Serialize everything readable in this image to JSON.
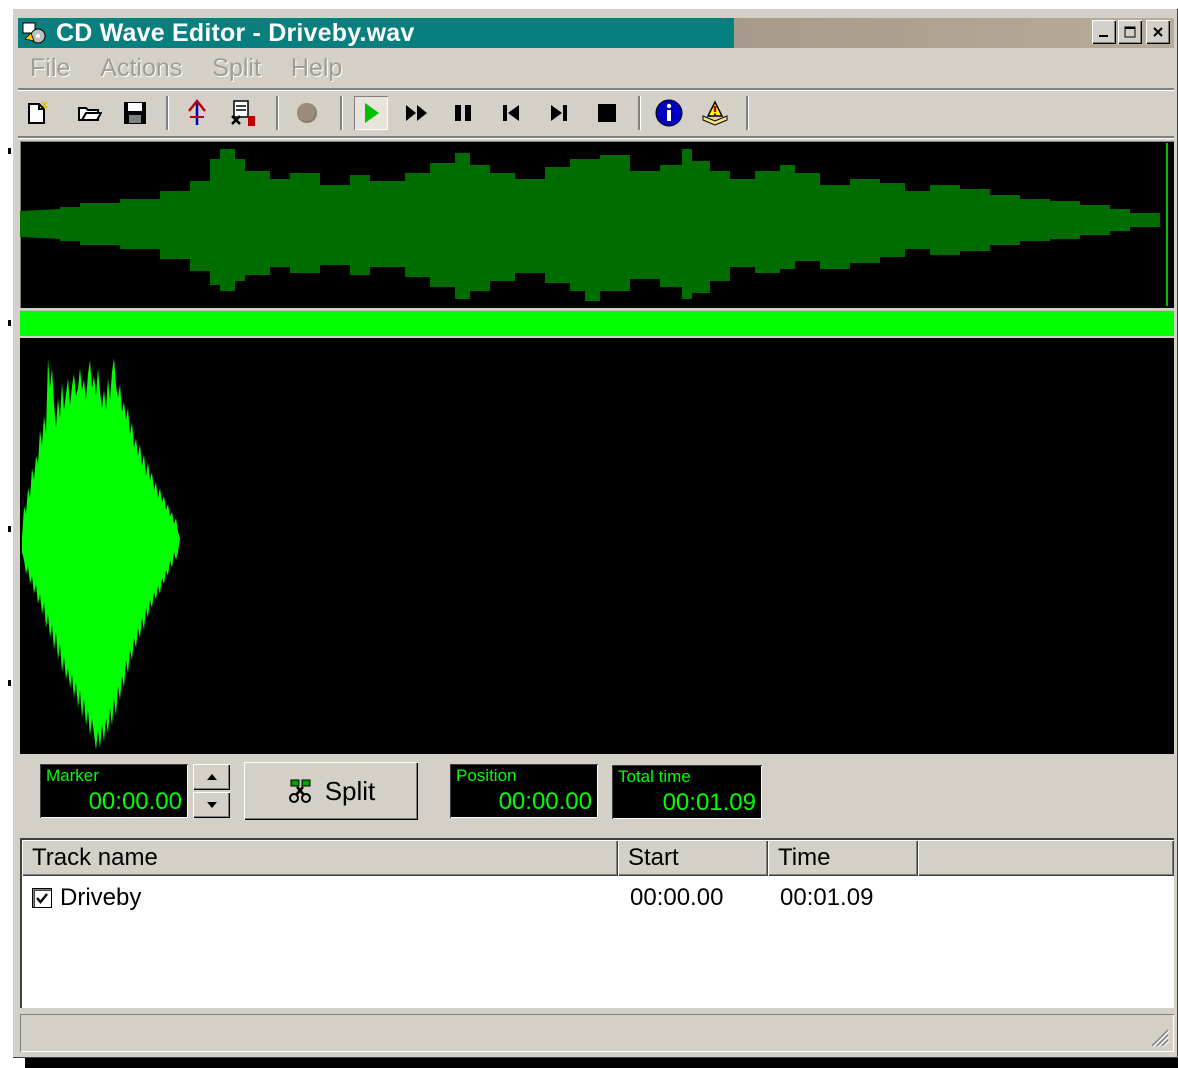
{
  "window": {
    "title": "CD Wave Editor - Driveby.wav",
    "minimize_symbol": "_",
    "maximize_symbol": "□",
    "close_symbol": "×"
  },
  "menu": [
    "File",
    "Actions",
    "Split",
    "Help"
  ],
  "toolbar": {
    "icons": [
      "new-file-icon",
      "open-folder-icon",
      "save-icon",
      "marker-arrow-icon",
      "auto-split-icon",
      "record-icon",
      "play-icon",
      "fast-forward-icon",
      "pause-icon",
      "skip-back-icon",
      "skip-forward-icon",
      "stop-icon",
      "info-icon",
      "help-book-icon"
    ]
  },
  "colors": {
    "waveform_overview": "#006d00",
    "waveform_detail": "#00ff00",
    "progress_strip": "#00ff00",
    "lcd_text": "#00ff00",
    "title_active": "#087f7f"
  },
  "controls": {
    "marker_label": "Marker",
    "marker_value": "00:00.00",
    "split_label": "Split",
    "position_label": "Position",
    "position_value": "00:00.00",
    "total_label": "Total time",
    "total_value": "00:01.09"
  },
  "tracklist": {
    "columns": [
      "Track name",
      "Start",
      "Time"
    ],
    "rows": [
      {
        "checked": true,
        "name": "Driveby",
        "start": "00:00.00",
        "time": "00:01.09"
      }
    ]
  }
}
